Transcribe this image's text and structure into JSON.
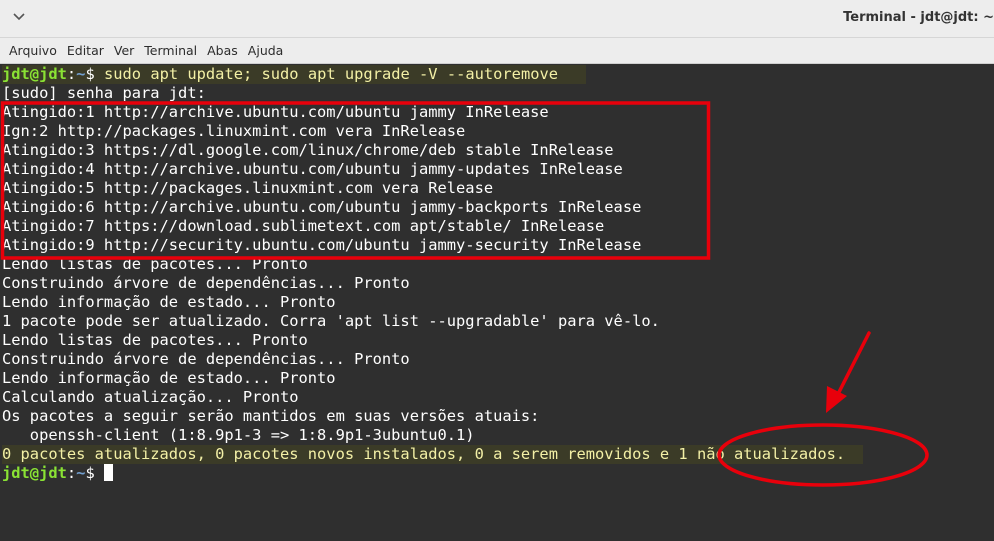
{
  "window": {
    "title": "Terminal - jdt@jdt: ~"
  },
  "menu": {
    "items": [
      "Arquivo",
      "Editar",
      "Ver",
      "Terminal",
      "Abas",
      "Ajuda"
    ]
  },
  "prompt": {
    "user_host": "jdt@jdt",
    "colon": ":",
    "path": "~",
    "symbol": "$ "
  },
  "command": "sudo apt update; sudo apt upgrade -V --autoremove",
  "output": [
    "[sudo] senha para jdt:",
    "Atingido:1 http://archive.ubuntu.com/ubuntu jammy InRelease",
    "Ign:2 http://packages.linuxmint.com vera InRelease",
    "Atingido:3 https://dl.google.com/linux/chrome/deb stable InRelease",
    "Atingido:4 http://archive.ubuntu.com/ubuntu jammy-updates InRelease",
    "Atingido:5 http://packages.linuxmint.com vera Release",
    "Atingido:6 http://archive.ubuntu.com/ubuntu jammy-backports InRelease",
    "Atingido:7 https://download.sublimetext.com apt/stable/ InRelease",
    "Atingido:9 http://security.ubuntu.com/ubuntu jammy-security InRelease",
    "Lendo listas de pacotes... Pronto",
    "Construindo árvore de dependências... Pronto",
    "Lendo informação de estado... Pronto",
    "1 pacote pode ser atualizado. Corra 'apt list --upgradable' para vê-lo.",
    "Lendo listas de pacotes... Pronto",
    "Construindo árvore de dependências... Pronto",
    "Lendo informação de estado... Pronto",
    "Calculando atualização... Pronto",
    "Os pacotes a seguir serão mantidos em suas versões atuais:",
    "   openssh-client (1:8.9p1-3 => 1:8.9p1-3ubuntu0.1)"
  ],
  "summary": "0 pacotes atualizados, 0 pacotes novos instalados, 0 a serem removidos e 1 não atualizados.",
  "colors": {
    "background": "#2f2f2f",
    "prompt_user": "#8ae234",
    "prompt_path": "#729fcf",
    "highlight_text": "#f3f0a6",
    "annotation": "#e8000b"
  }
}
